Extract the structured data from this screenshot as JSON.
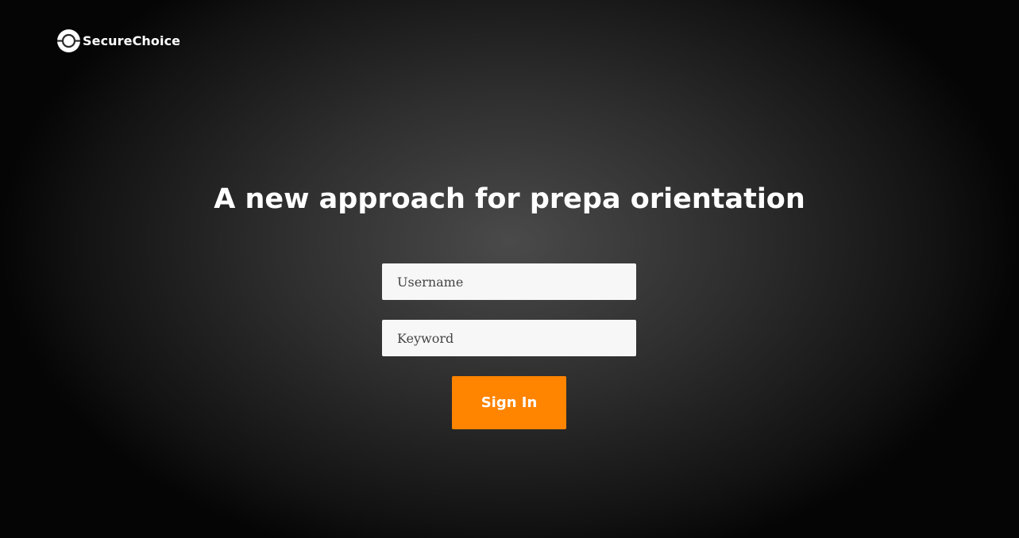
{
  "brand": {
    "name": "SecureChoice",
    "icon": "target-circle-icon"
  },
  "hero": {
    "headline": "A new approach for prepa orientation"
  },
  "login_form": {
    "username_placeholder": "Username",
    "username_value": "",
    "keyword_placeholder": "Keyword",
    "keyword_value": "",
    "submit_label": "Sign In"
  },
  "colors": {
    "accent": "#ff8400",
    "field_background": "#f7f7f7",
    "text": "#ffffff"
  }
}
